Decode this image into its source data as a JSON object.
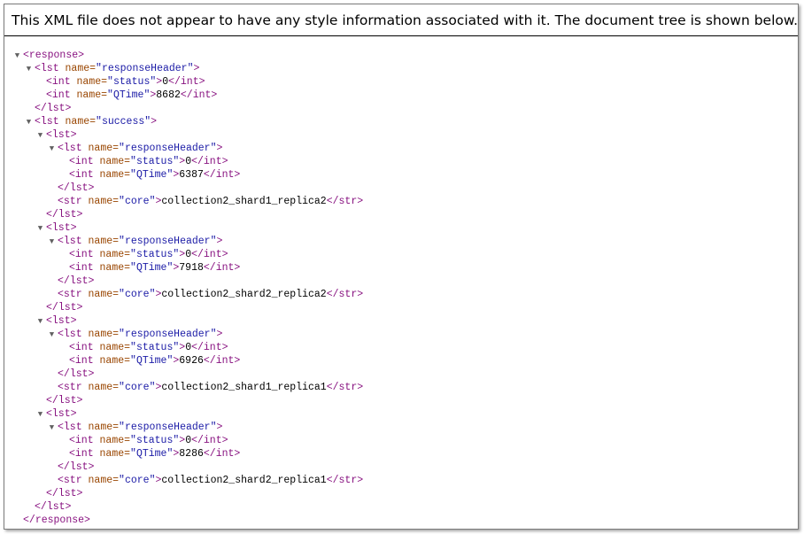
{
  "notice": "This XML file does not appear to have any style information associated with it. The document tree is shown below.",
  "icons": {
    "expanded": "triangle-down-icon"
  },
  "colors": {
    "tag": "#881280",
    "attr_name": "#994500",
    "attr_value": "#1a1aa6",
    "text": "#000000"
  },
  "lines": [
    {
      "indent": 0,
      "toggle": true,
      "kind": "open",
      "tag": "response"
    },
    {
      "indent": 1,
      "toggle": true,
      "kind": "open",
      "tag": "lst",
      "attr": "name",
      "value": "responseHeader"
    },
    {
      "indent": 2,
      "toggle": false,
      "kind": "leaf",
      "tag": "int",
      "attr": "name",
      "value": "status",
      "text": "0"
    },
    {
      "indent": 2,
      "toggle": false,
      "kind": "leaf",
      "tag": "int",
      "attr": "name",
      "value": "QTime",
      "text": "8682"
    },
    {
      "indent": 1,
      "toggle": false,
      "kind": "close",
      "tag": "lst"
    },
    {
      "indent": 1,
      "toggle": true,
      "kind": "open",
      "tag": "lst",
      "attr": "name",
      "value": "success"
    },
    {
      "indent": 2,
      "toggle": true,
      "kind": "open",
      "tag": "lst"
    },
    {
      "indent": 3,
      "toggle": true,
      "kind": "open",
      "tag": "lst",
      "attr": "name",
      "value": "responseHeader"
    },
    {
      "indent": 4,
      "toggle": false,
      "kind": "leaf",
      "tag": "int",
      "attr": "name",
      "value": "status",
      "text": "0"
    },
    {
      "indent": 4,
      "toggle": false,
      "kind": "leaf",
      "tag": "int",
      "attr": "name",
      "value": "QTime",
      "text": "6387"
    },
    {
      "indent": 3,
      "toggle": false,
      "kind": "close",
      "tag": "lst"
    },
    {
      "indent": 3,
      "toggle": false,
      "kind": "leaf",
      "tag": "str",
      "attr": "name",
      "value": "core",
      "text": "collection2_shard1_replica2"
    },
    {
      "indent": 2,
      "toggle": false,
      "kind": "close",
      "tag": "lst"
    },
    {
      "indent": 2,
      "toggle": true,
      "kind": "open",
      "tag": "lst"
    },
    {
      "indent": 3,
      "toggle": true,
      "kind": "open",
      "tag": "lst",
      "attr": "name",
      "value": "responseHeader"
    },
    {
      "indent": 4,
      "toggle": false,
      "kind": "leaf",
      "tag": "int",
      "attr": "name",
      "value": "status",
      "text": "0"
    },
    {
      "indent": 4,
      "toggle": false,
      "kind": "leaf",
      "tag": "int",
      "attr": "name",
      "value": "QTime",
      "text": "7918"
    },
    {
      "indent": 3,
      "toggle": false,
      "kind": "close",
      "tag": "lst"
    },
    {
      "indent": 3,
      "toggle": false,
      "kind": "leaf",
      "tag": "str",
      "attr": "name",
      "value": "core",
      "text": "collection2_shard2_replica2"
    },
    {
      "indent": 2,
      "toggle": false,
      "kind": "close",
      "tag": "lst"
    },
    {
      "indent": 2,
      "toggle": true,
      "kind": "open",
      "tag": "lst"
    },
    {
      "indent": 3,
      "toggle": true,
      "kind": "open",
      "tag": "lst",
      "attr": "name",
      "value": "responseHeader"
    },
    {
      "indent": 4,
      "toggle": false,
      "kind": "leaf",
      "tag": "int",
      "attr": "name",
      "value": "status",
      "text": "0"
    },
    {
      "indent": 4,
      "toggle": false,
      "kind": "leaf",
      "tag": "int",
      "attr": "name",
      "value": "QTime",
      "text": "6926"
    },
    {
      "indent": 3,
      "toggle": false,
      "kind": "close",
      "tag": "lst"
    },
    {
      "indent": 3,
      "toggle": false,
      "kind": "leaf",
      "tag": "str",
      "attr": "name",
      "value": "core",
      "text": "collection2_shard1_replica1"
    },
    {
      "indent": 2,
      "toggle": false,
      "kind": "close",
      "tag": "lst"
    },
    {
      "indent": 2,
      "toggle": true,
      "kind": "open",
      "tag": "lst"
    },
    {
      "indent": 3,
      "toggle": true,
      "kind": "open",
      "tag": "lst",
      "attr": "name",
      "value": "responseHeader"
    },
    {
      "indent": 4,
      "toggle": false,
      "kind": "leaf",
      "tag": "int",
      "attr": "name",
      "value": "status",
      "text": "0"
    },
    {
      "indent": 4,
      "toggle": false,
      "kind": "leaf",
      "tag": "int",
      "attr": "name",
      "value": "QTime",
      "text": "8286"
    },
    {
      "indent": 3,
      "toggle": false,
      "kind": "close",
      "tag": "lst"
    },
    {
      "indent": 3,
      "toggle": false,
      "kind": "leaf",
      "tag": "str",
      "attr": "name",
      "value": "core",
      "text": "collection2_shard2_replica1"
    },
    {
      "indent": 2,
      "toggle": false,
      "kind": "close",
      "tag": "lst"
    },
    {
      "indent": 1,
      "toggle": false,
      "kind": "close",
      "tag": "lst"
    },
    {
      "indent": 0,
      "toggle": false,
      "kind": "close",
      "tag": "response"
    }
  ]
}
